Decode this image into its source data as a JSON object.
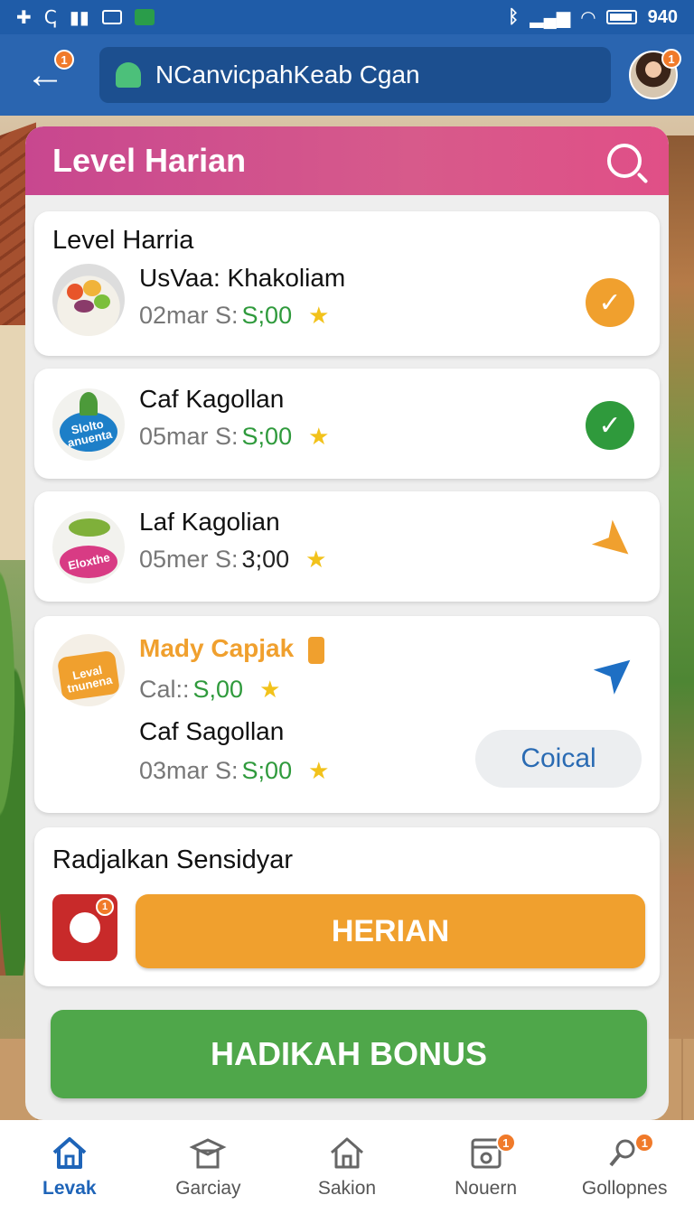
{
  "status_bar": {
    "time": "940"
  },
  "app_bar": {
    "back_badge": "1",
    "search_text": "NCanvicpahKeab Cgan",
    "avatar_badge": "1"
  },
  "panel": {
    "header_title": "Level Harian",
    "section_title": "Level Harria",
    "items": [
      {
        "title": "UsVaa: Khakoliam",
        "meta": "02mar S:",
        "value": "S;00",
        "status": "done-orange",
        "thumb": "fruit-bowl"
      },
      {
        "title": "Caf Kagollan",
        "meta": "05mar S:",
        "value": "S;00",
        "status": "done-green",
        "thumb_label": "Slolto anuenta"
      },
      {
        "title": "Laf Kagolian",
        "meta": "05mer S:",
        "value": "3;00",
        "status": "arrow-orange",
        "thumb_label": "Eloxthe"
      },
      {
        "title": "Mady Capjak",
        "meta": "Cal::",
        "value": "S,00",
        "status": "arrow-blue",
        "thumb_label": "Leval tnunena",
        "sub_title": "Caf Sagollan",
        "sub_meta": "03mar S:",
        "sub_value": "S;00",
        "action_label": "Coical"
      }
    ],
    "reminder": {
      "title": "Radjalkan Sensidyar",
      "badge": "1",
      "button_label": "HERIAN"
    },
    "bonus_button": "HADIKAH BONUS"
  },
  "bottom_nav": [
    {
      "label": "Levak",
      "icon": "home-icon",
      "active": true
    },
    {
      "label": "Garciay",
      "icon": "graduation-icon"
    },
    {
      "label": "Sakion",
      "icon": "house-outline-icon"
    },
    {
      "label": "Nouern",
      "icon": "calendar-icon",
      "badge": "1"
    },
    {
      "label": "Gollopnes",
      "icon": "search-person-icon",
      "badge": "1"
    }
  ],
  "colors": {
    "primary": "#2a65b0",
    "header_pink": "#d75a8b",
    "accent_orange": "#f0a02e",
    "accent_green": "#4fa74a"
  }
}
